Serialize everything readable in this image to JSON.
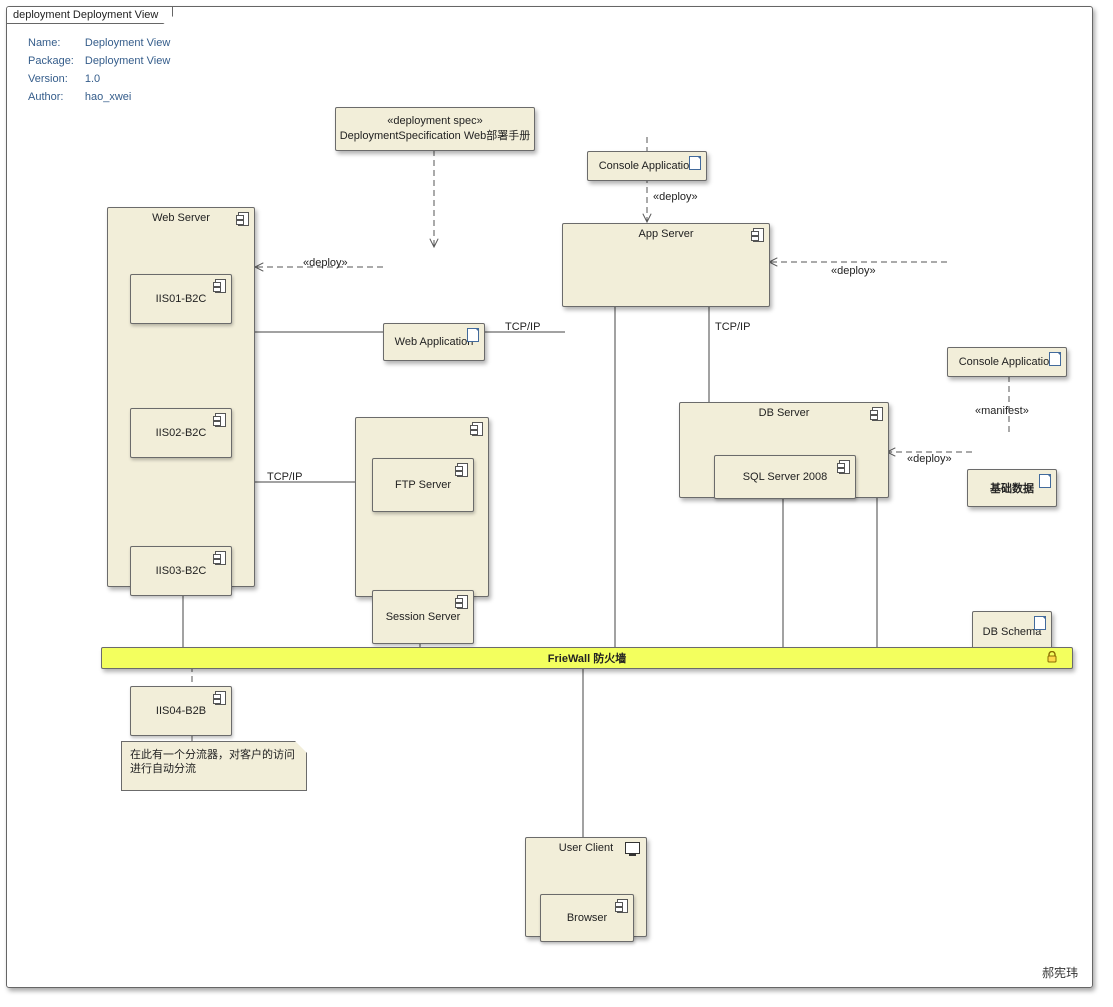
{
  "tab": "deployment Deployment View",
  "meta": {
    "name_label": "Name:",
    "name": "Deployment View",
    "package_label": "Package:",
    "package": "Deployment View",
    "version_label": "Version:",
    "version": "1.0",
    "author_label": "Author:",
    "author": "hao_xwei"
  },
  "elements": {
    "dep_spec": {
      "stereo": "«deployment spec»",
      "name": "DeploymentSpecification Web部署手册"
    },
    "console_app_top": "Console Application",
    "web_app": "Web Application",
    "web_server": {
      "title": "Web Server",
      "components": [
        "IIS01-B2C",
        "IIS02-B2C",
        "IIS03-B2C",
        "IIS04-B2B"
      ]
    },
    "app_server": {
      "title": "App Server"
    },
    "console_app_right": "Console Application",
    "base_data": "基础数据",
    "db_schema": "DB Schema",
    "db_server": {
      "title": "DB Server",
      "component": "SQL Server 2008"
    },
    "mid_server": {
      "title": "",
      "components": [
        "FTP Server",
        "Session Server"
      ]
    },
    "firewall": "FrieWall 防火墙",
    "note_text": "在此有一个分流器，对客户的访问进行自动分流",
    "user_client": {
      "title": "User Client",
      "component": "Browser"
    }
  },
  "labels": {
    "deploy": "«deploy»",
    "manifest": "«manifest»",
    "tcpip": "TCP/IP"
  },
  "footer_author": "郝宪玮"
}
